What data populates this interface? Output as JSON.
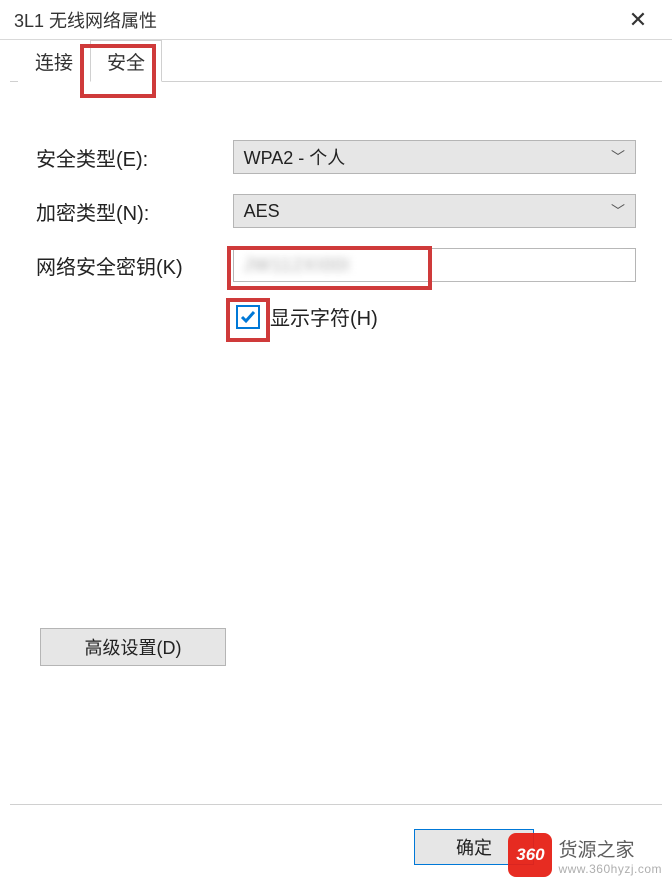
{
  "window": {
    "title": "3L1 无线网络属性"
  },
  "tabs": {
    "connection": "连接",
    "security": "安全"
  },
  "labels": {
    "security_type": "安全类型(E):",
    "encryption_type": "加密类型(N):",
    "network_key": "网络安全密钥(K)",
    "show_chars": "显示字符(H)"
  },
  "values": {
    "security_type": "WPA2 - 个人",
    "encryption_type": "AES",
    "network_key": "JW112XI00I",
    "show_chars_checked": true
  },
  "buttons": {
    "advanced": "高级设置(D)",
    "ok": "确定"
  },
  "watermark": {
    "badge": "360",
    "text": "货源之家",
    "url": "www.360hyzj.com"
  }
}
